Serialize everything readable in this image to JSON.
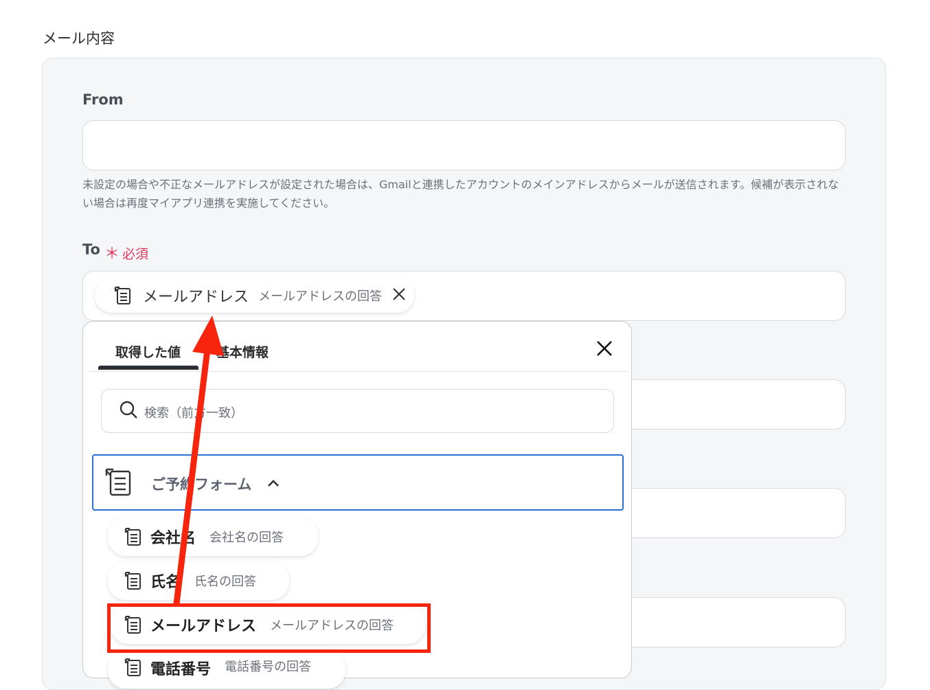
{
  "section": {
    "title": "メール内容"
  },
  "from": {
    "label": "From",
    "value": "",
    "help": "未設定の場合や不正なメールアドレスが設定された場合は、Gmailと連携したアカウントのメインアドレスからメールが送信されます。候補が表示されない場合は再度マイアプリ連携を実施してください。"
  },
  "to": {
    "label": "To",
    "required_mark": "＊",
    "required_text": "必須",
    "chip": {
      "main": "メールアドレス",
      "sub": "メールアドレスの回答"
    }
  },
  "popup": {
    "tabs": [
      {
        "label": "取得した値",
        "active": true
      },
      {
        "label": "基本情報",
        "active": false
      }
    ],
    "search_placeholder": "検索（前方一致）",
    "group": {
      "label": "ご予約フォーム",
      "expanded": true
    },
    "options": [
      {
        "main": "会社名",
        "sub": "会社名の回答"
      },
      {
        "main": "氏名",
        "sub": "氏名の回答"
      },
      {
        "main": "メールアドレス",
        "sub": "メールアドレスの回答"
      },
      {
        "main": "電話番号",
        "sub": "電話番号の回答"
      }
    ]
  },
  "colors": {
    "accent": "#2a6fd4",
    "required": "#e03a5f",
    "annotation": "#f7240e",
    "card_bg": "#f5f6f8"
  },
  "icons": [
    "form-icon",
    "close-icon",
    "search-icon",
    "chevron-up-icon"
  ]
}
